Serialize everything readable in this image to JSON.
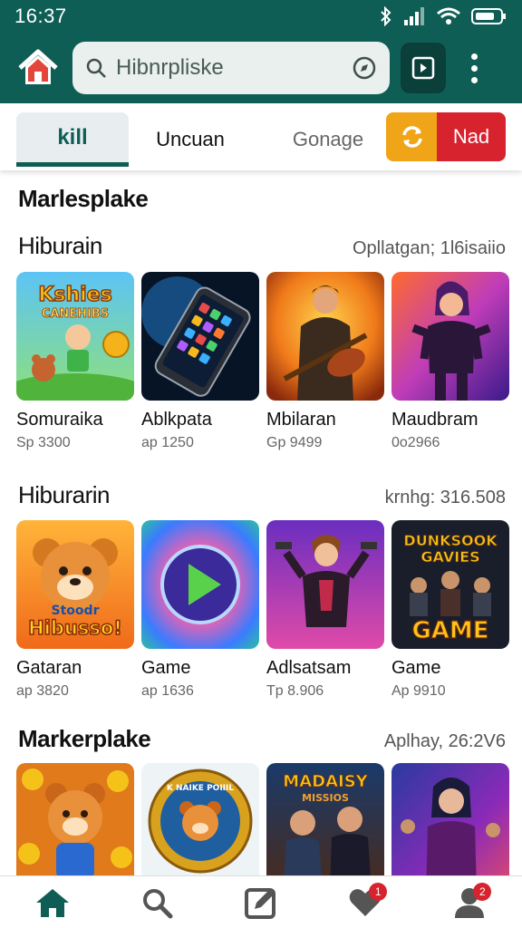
{
  "status_bar": {
    "time": "16:37"
  },
  "search": {
    "query": "Hibnrpliske"
  },
  "tabs": [
    {
      "label": "kill"
    },
    {
      "label": "Uncuan"
    },
    {
      "label": "Gonage"
    }
  ],
  "actions": {
    "nad_label": "Nad"
  },
  "page_heading": "Marlesplake",
  "sections": [
    {
      "title": "Hiburain",
      "meta": "Opllatgan; 1l6isaiio",
      "items": [
        {
          "title": "Somuraika",
          "price": "Sp 3300",
          "art": "kids-coins-game"
        },
        {
          "title": "Ablkpata",
          "price": "ap 1250",
          "art": "smartphone-apps"
        },
        {
          "title": "Mbilaran",
          "price": "Gp 9499",
          "art": "rock-guitarist"
        },
        {
          "title": "Maudbram",
          "price": "0o2966",
          "art": "heroine-fighter"
        }
      ]
    },
    {
      "title": "Hiburarin",
      "meta": "krnhg: 316.508",
      "items": [
        {
          "title": "Gataran",
          "price": "ap 3820",
          "art": "bear-game"
        },
        {
          "title": "Game",
          "price": "ap 1636",
          "art": "play-button"
        },
        {
          "title": "Adlsatsam",
          "price": "Tp 8.906",
          "art": "gunner-hero"
        },
        {
          "title": "Game",
          "price": "Ap 9910",
          "art": "dungeon-game"
        }
      ]
    },
    {
      "title": "Markerplake",
      "meta": "Aplhay, 26:2V6",
      "items": [
        {
          "title": "",
          "price": "",
          "art": "bear-coins"
        },
        {
          "title": "",
          "price": "",
          "art": "bear-badge"
        },
        {
          "title": "",
          "price": "",
          "art": "movie-poster"
        },
        {
          "title": "",
          "price": "",
          "art": "neon-heroine"
        }
      ]
    }
  ],
  "thumb_art_text": {
    "kids_line1": "Kshies",
    "kids_line2": "CANEHIBS",
    "bear_line1": "Stoodr",
    "bear_line2": "Hibusso!",
    "dungeon_line1": "DUNKSOOK",
    "dungeon_line2": "GAVIES",
    "dungeon_line3": "GAME",
    "badge_text": "K NAIKE POIIIL",
    "poster_line1": "MADAISY",
    "poster_line2": "MISSIOS"
  },
  "nav": [
    {
      "icon": "home-icon"
    },
    {
      "icon": "search-icon"
    },
    {
      "icon": "edit-icon"
    },
    {
      "icon": "heart-icon",
      "badge": "1"
    },
    {
      "icon": "profile-icon",
      "badge": "2"
    }
  ],
  "colors": {
    "primary": "#0f5e55",
    "accent_orange": "#f0a417",
    "accent_red": "#d6232e"
  }
}
